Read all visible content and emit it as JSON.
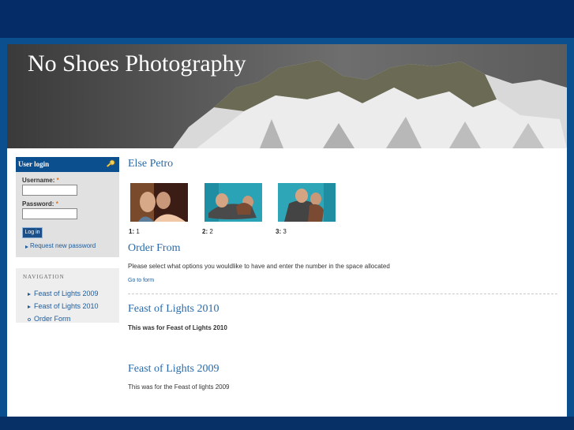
{
  "site": {
    "title": "No Shoes Photography"
  },
  "login": {
    "title": "User login",
    "username_label": "Username:",
    "password_label": "Password:",
    "required_mark": "*",
    "username_value": "",
    "password_value": "",
    "submit_label": "Log in",
    "request_password_link": "Request new password"
  },
  "navigation": {
    "title": "NAVIGATION",
    "items": [
      {
        "label": "Feast of Lights 2009"
      },
      {
        "label": "Feast of Lights 2010"
      },
      {
        "label": "Order Form"
      }
    ]
  },
  "content": {
    "album_title": "Else Petro",
    "thumbnails": [
      {
        "num": "1:",
        "label": "1"
      },
      {
        "num": "2:",
        "label": "2"
      },
      {
        "num": "3:",
        "label": "3"
      }
    ],
    "order": {
      "title": "Order From",
      "text": "Please select what options you wouldlike to have and enter the number in the space allocated",
      "link": "Go to form"
    },
    "posts": [
      {
        "title": "Feast of Lights 2010",
        "body": "This was for Feast of Lights 2010"
      },
      {
        "title": "Feast of Lights 2009",
        "body": "This was for the Feast of lights 2009"
      }
    ]
  },
  "colors": {
    "accent": "#0c4f8e",
    "link": "#1d5b9a",
    "heading": "#2a6aa8",
    "required": "#e07020"
  },
  "icons": {
    "login": "key-icon",
    "nav_bullet": "triangle-bullet-icon",
    "nav_current": "circle-bullet-icon"
  }
}
